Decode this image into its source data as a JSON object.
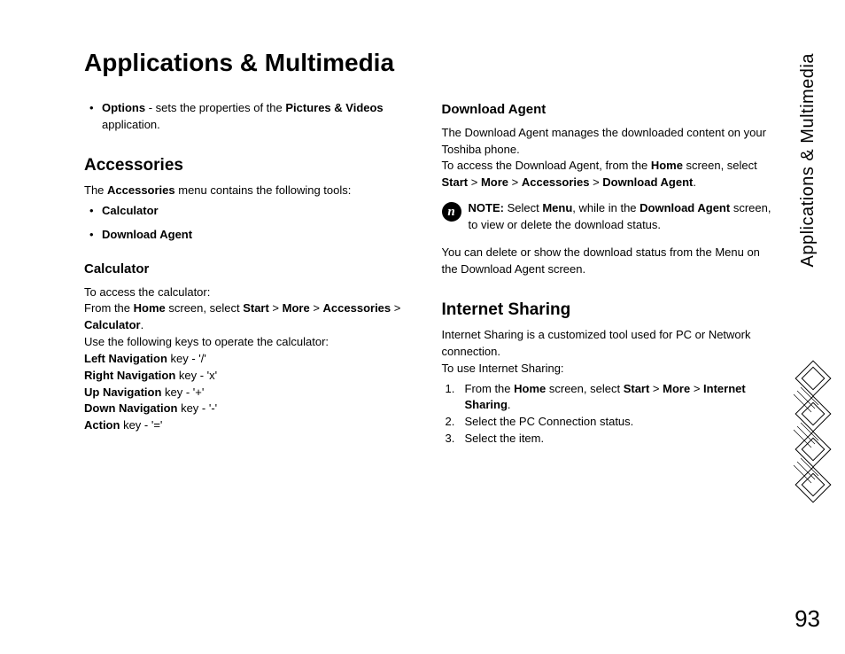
{
  "title": "Applications & Multimedia",
  "side_label": "Applications & Multimedia",
  "page_number": "93",
  "left": {
    "options_bullet": {
      "pre": "Options",
      "mid1": " - sets the properties of the ",
      "app": "Pictures & Videos",
      "mid2": " application."
    },
    "accessories_heading": "Accessories",
    "accessories_intro_pre": "The ",
    "accessories_intro_bold": "Accessories",
    "accessories_intro_post": " menu contains the following tools:",
    "acc_item1": "Calculator",
    "acc_item2": "Download Agent",
    "calc_heading": "Calculator",
    "calc_intro": "To access the calculator:",
    "calc_path_pre": "From the ",
    "calc_path_b1": "Home",
    "calc_path_m1": " screen, select ",
    "calc_path_b2": "Start",
    "calc_path_gt1": " > ",
    "calc_path_b3": "More",
    "calc_path_gt2": " > ",
    "calc_path_b4": "Accessories",
    "calc_path_gt3": " > ",
    "calc_path_b5": "Calculator",
    "calc_path_end": ".",
    "calc_use": "Use the following keys to operate the calculator:",
    "k1b": "Left Navigation",
    "k1t": " key - '/'",
    "k2b": "Right Navigation",
    "k2t": " key - 'x'",
    "k3b": "Up Navigation",
    "k3t": " key - '+'",
    "k4b": "Down Navigation",
    "k4t": " key - '-'",
    "k5b": "Action",
    "k5t": " key - '='"
  },
  "right": {
    "da_heading": "Download Agent",
    "da_intro": "The Download Agent manages the downloaded content on your Toshiba phone.",
    "da_path_pre": "To access the Download Agent, from the ",
    "da_b1": "Home",
    "da_m1": " screen, select ",
    "da_b2": "Start",
    "da_gt1": " > ",
    "da_b3": "More",
    "da_gt2": " > ",
    "da_b4": "Accessories",
    "da_gt3": " > ",
    "da_b5": "Download Agent",
    "da_end": ".",
    "note_icon": "n",
    "note_pre": "NOTE:",
    "note_m1": " Select ",
    "note_b1": "Menu",
    "note_m2": ", while in the ",
    "note_b2": "Download Agent",
    "note_m3": " screen, to view or delete the download status.",
    "da_post": "You can delete or show the download status from the Menu on the Download Agent screen.",
    "is_heading": "Internet Sharing",
    "is_intro": "Internet Sharing is a customized tool used for PC or Network connection.",
    "is_use": "To use Internet Sharing:",
    "is1_pre": "From the ",
    "is1_b1": "Home",
    "is1_m1": " screen, select ",
    "is1_b2": "Start",
    "is1_gt1": " > ",
    "is1_b3": "More",
    "is1_gt2": " > ",
    "is1_b4": "Internet Sharing",
    "is1_end": ".",
    "is2": "Select the PC Connection status.",
    "is3": "Select the item.",
    "n1": "1.",
    "n2": "2.",
    "n3": "3."
  }
}
